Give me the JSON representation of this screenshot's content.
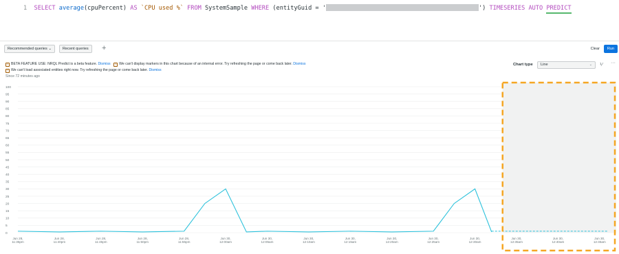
{
  "editor": {
    "line_number": "1",
    "tokens": {
      "select": "SELECT",
      "fn_average": "average",
      "arg": "(cpuPercent)",
      "as": "AS",
      "alias": "`CPU used %`",
      "from": "FROM",
      "table": "SystemSample",
      "where": "WHERE",
      "cond_open": "(entityGuid = '",
      "cond_close": "')",
      "timeseries": "TIMESERIES",
      "auto": "AUTO",
      "predict": "PREDICT"
    }
  },
  "toolbar": {
    "recommended": "Recommended queries ⌄",
    "recent": "Recent queries",
    "plus": "+",
    "clear": "Clear",
    "run": "Run"
  },
  "notices": {
    "beta_text": "BETA FEATURE USE: NRQL Predict is a beta feature.",
    "dismiss": "Dismiss",
    "markers_text": "We can't display markers in this chart because of an internal error. Try refreshing the page or come back later.",
    "entities_text": "We can't load associated entities right now. Try refreshing the page or come back later.",
    "since": "Since 72 minutes ago"
  },
  "chart_type": {
    "label": "Chart type",
    "value": "Line"
  },
  "colors": {
    "series": "#2bc1db",
    "highlight": "#f5a623",
    "predict_bg": "#f1f2f2",
    "grid": "#eceeee"
  },
  "chart_data": {
    "type": "line",
    "ylim": [
      0,
      100
    ],
    "y_ticks": [
      0,
      5,
      10,
      15,
      20,
      25,
      30,
      35,
      40,
      45,
      50,
      55,
      60,
      65,
      70,
      75,
      80,
      85,
      90,
      95,
      100
    ],
    "x_ticks": [
      {
        "l1": "Jun 28,",
        "l2": "11:35pm"
      },
      {
        "l1": "Jun 28,",
        "l2": "11:40pm"
      },
      {
        "l1": "Jun 28,",
        "l2": "11:45pm"
      },
      {
        "l1": "Jun 28,",
        "l2": "11:50pm"
      },
      {
        "l1": "Jun 28,",
        "l2": "11:55pm"
      },
      {
        "l1": "Jun 30,",
        "l2": "12:00am"
      },
      {
        "l1": "Jun 30,",
        "l2": "12:05am"
      },
      {
        "l1": "Jun 30,",
        "l2": "12:10am"
      },
      {
        "l1": "Jun 30,",
        "l2": "12:15am"
      },
      {
        "l1": "Jun 30,",
        "l2": "12:20am"
      },
      {
        "l1": "Jun 30,",
        "l2": "12:25am"
      },
      {
        "l1": "Jun 30,",
        "l2": "12:30am"
      },
      {
        "l1": "Jun 30,",
        "l2": "12:35am"
      },
      {
        "l1": "Jun 30,",
        "l2": "12:40am"
      },
      {
        "l1": "Jun 30,",
        "l2": "12:45am"
      }
    ],
    "series": [
      {
        "x": [
          0,
          1,
          2,
          3,
          4,
          4.5,
          5,
          5.5,
          6,
          7,
          8,
          9,
          10,
          10.5,
          11,
          11.4
        ],
        "y": [
          1,
          0.5,
          1,
          0.5,
          1,
          20,
          30,
          0.5,
          1,
          0.5,
          1,
          0.5,
          1,
          20,
          30,
          0.5
        ]
      },
      {
        "x": [
          11.4,
          14.2
        ],
        "y": [
          1,
          1
        ],
        "style": "dashed"
      }
    ],
    "predict_region": [
      11.4,
      14.2
    ]
  }
}
